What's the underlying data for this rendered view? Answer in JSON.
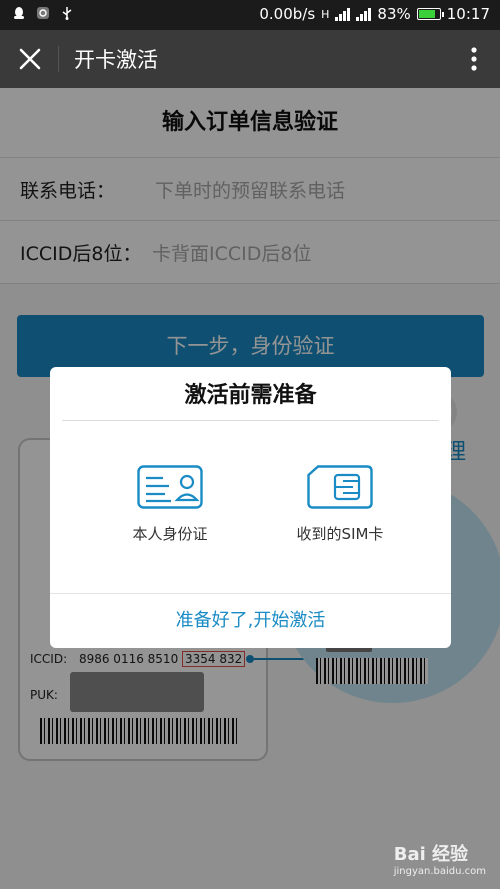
{
  "status_bar": {
    "network_speed": "0.00b/s",
    "network_type": "H",
    "battery_percent": "83%",
    "battery_level": 0.83,
    "time": "10:17"
  },
  "header": {
    "title": "开卡激活",
    "close_icon": "close-icon",
    "more_icon": "more-vertical-icon"
  },
  "form": {
    "heading": "输入订单信息验证",
    "phone_label": "联系电话：",
    "phone_placeholder": "下单时的预留联系电话",
    "iccid_label": "ICCID后8位：",
    "iccid_placeholder": "卡背面ICCID后8位",
    "submit_label": "下一步，身份验证",
    "partial_link": "理"
  },
  "illustration": {
    "iccid_prefix": "ICCID:",
    "iccid_digits": "8986 0116 8510",
    "iccid_highlight": "3354 832",
    "puk_label": "PUK:"
  },
  "modal": {
    "title": "激活前需准备",
    "options": [
      {
        "label": "本人身份证",
        "icon": "id-card-icon"
      },
      {
        "label": "收到的SIM卡",
        "icon": "sim-card-icon"
      }
    ],
    "action_label": "准备好了,开始激活"
  },
  "watermark": {
    "text": "Bai 经验",
    "sub": "jingyan.baidu.com"
  },
  "colors": {
    "accent": "#1a8bc4",
    "header_bg": "#3a3a3a",
    "status_bg": "#1b1b1b"
  }
}
